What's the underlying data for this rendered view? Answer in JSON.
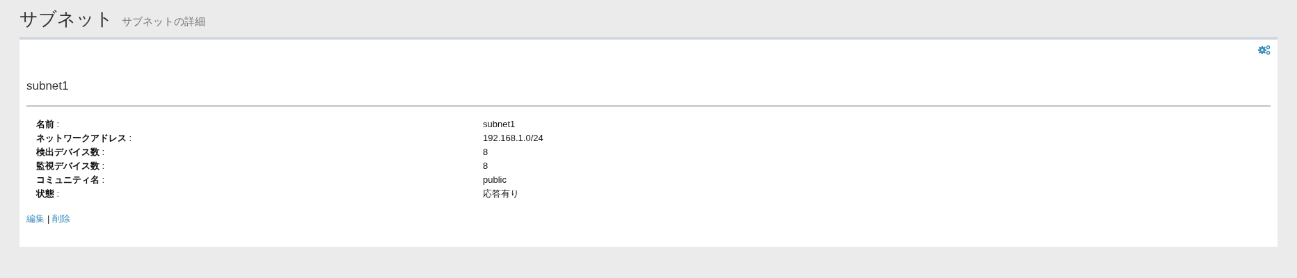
{
  "page": {
    "title": "サブネット",
    "subtitle": "サブネットの詳細"
  },
  "panel": {
    "heading": "subnet1",
    "details": [
      {
        "label": "**名前** :",
        "value": "subnet1"
      },
      {
        "label": "**ネットワークアドレス** :",
        "value": "192.168.1.0/24"
      },
      {
        "label": "**検出デバイス数** :",
        "value": "8"
      },
      {
        "label": "**監視デバイス数** :",
        "value": "8"
      },
      {
        "label": "**コミュニティ名** :",
        "value": "public"
      },
      {
        "label": "**状態** :",
        "value": "応答有り"
      }
    ],
    "actions": [
      {
        "label": "編集"
      },
      {
        "label": "削除"
      }
    ],
    "action_separator": "|"
  }
}
